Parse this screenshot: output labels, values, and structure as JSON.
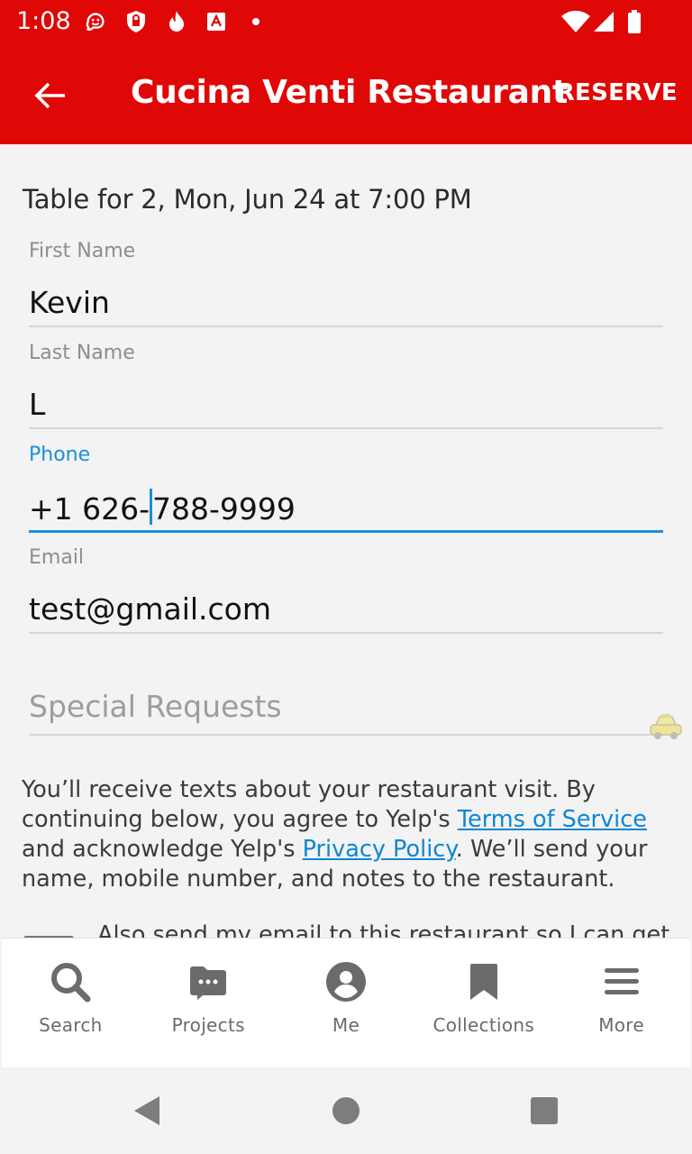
{
  "status_bar": {
    "time": "1:08",
    "icons": [
      "waze-icon",
      "shield-lock-icon",
      "fire-icon",
      "acrobat-icon",
      "dot-icon",
      "wifi-icon",
      "signal-icon",
      "battery-icon"
    ]
  },
  "app_bar": {
    "title": "Cucina Venti Restaurant",
    "action": "RESERVE",
    "back_icon": "arrow-left-icon"
  },
  "summary": "Table for 2, Mon, Jun 24 at 7:00 PM",
  "form": {
    "first_name": {
      "label": "First Name",
      "value": "Kevin"
    },
    "last_name": {
      "label": "Last Name",
      "value": "L"
    },
    "phone": {
      "label": "Phone",
      "value_before_cursor": "+1 626-",
      "value_after_cursor": "788-9999"
    },
    "email": {
      "label": "Email",
      "value": "test@gmail.com"
    },
    "special_requests": {
      "placeholder": "Special Requests"
    }
  },
  "notice": {
    "part1": "You’ll receive texts about your restaurant visit. By continuing below, you agree to Yelp's ",
    "terms_link": "Terms of Service",
    "part2": " and acknowledge Yelp's ",
    "privacy_link": "Privacy Policy",
    "part3": ". We’ll send your name, mobile number, and notes to the restaurant."
  },
  "email_optin_text": "Also send my email to this restaurant so I can get",
  "bottom_nav": [
    {
      "label": "Search",
      "icon": "search-icon"
    },
    {
      "label": "Projects",
      "icon": "projects-folder-icon"
    },
    {
      "label": "Me",
      "icon": "profile-icon"
    },
    {
      "label": "Collections",
      "icon": "bookmark-icon"
    },
    {
      "label": "More",
      "icon": "menu-icon"
    }
  ],
  "colors": {
    "brand_red": "#e00707",
    "active_blue": "#1a8fd6",
    "link_blue": "#0e86d4"
  }
}
